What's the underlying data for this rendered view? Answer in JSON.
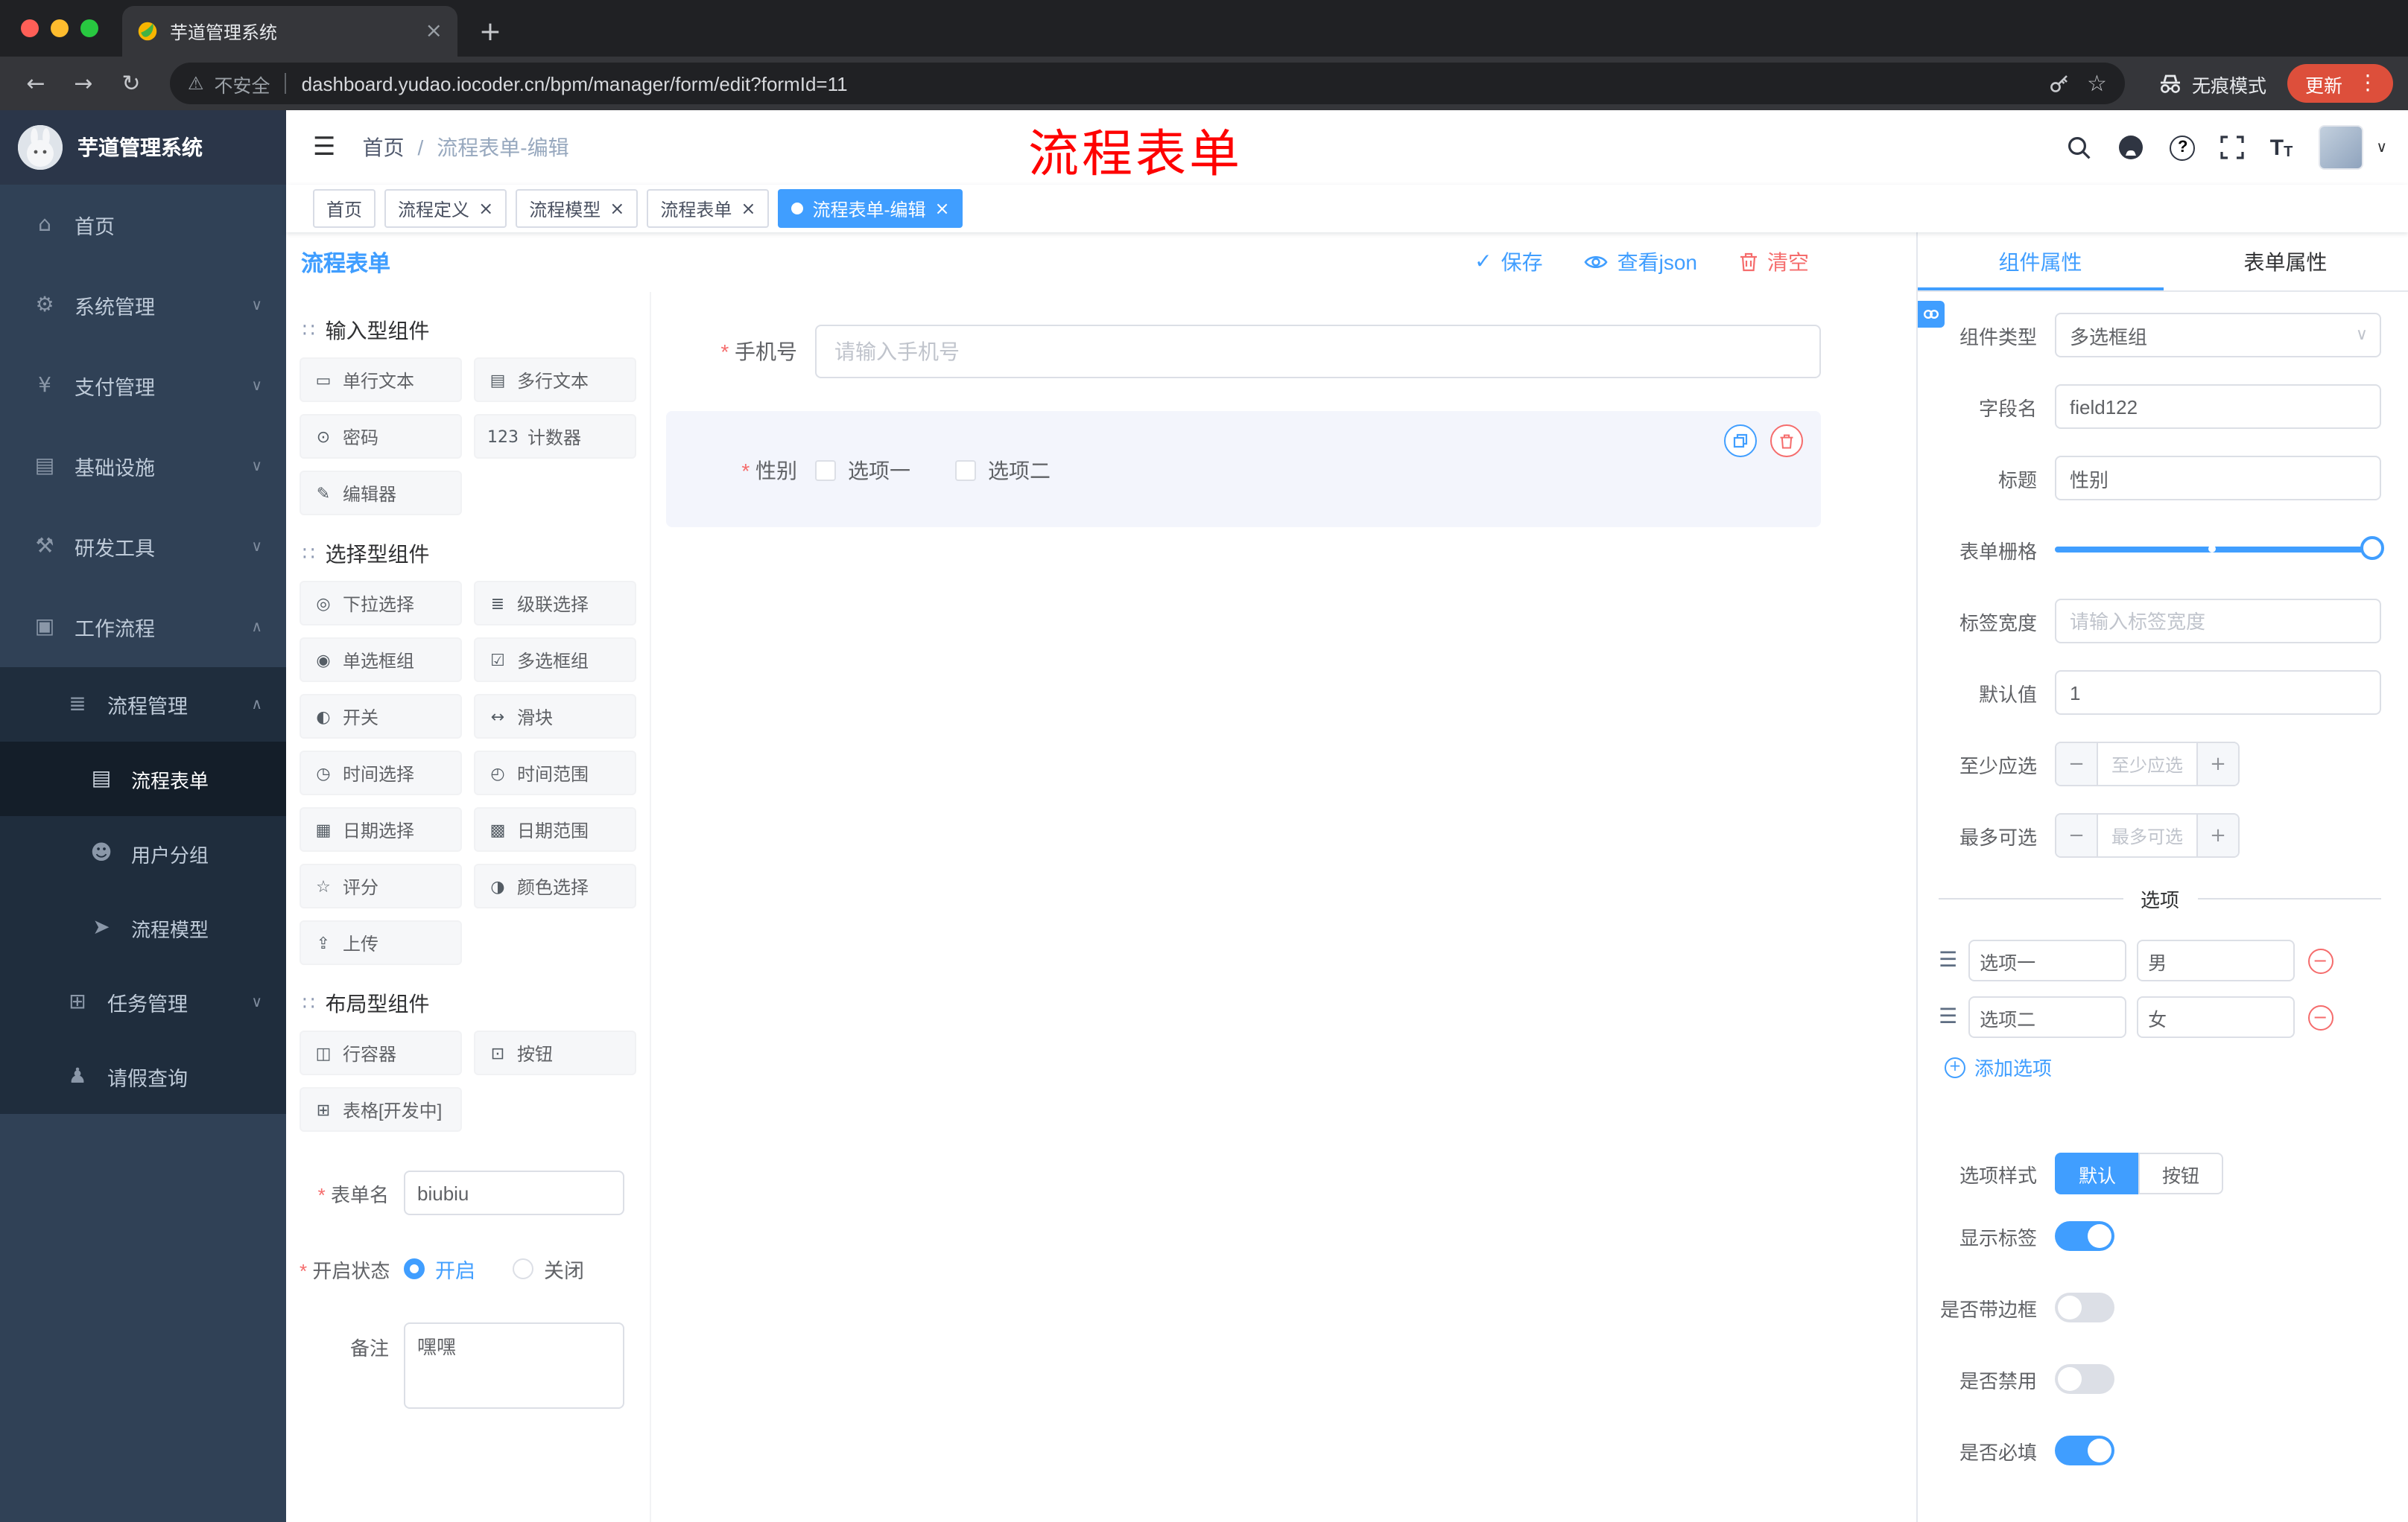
{
  "icons": {
    "close": "×",
    "plus": "+",
    "dots": "⋮",
    "back": "←",
    "forward": "→",
    "reload": "↻",
    "warning": "⚠",
    "star": "☆",
    "caret_down": "∨",
    "caret_up": "∧",
    "check": "✓",
    "hamburger": "☰",
    "minus": "−",
    "grabber": "∷",
    "handle": "☰",
    "font_big": "T",
    "font_small": "T",
    "question": "?",
    "slash": "/"
  },
  "browser": {
    "tab_title": "芋道管理系统",
    "security_label": "不安全",
    "url": "dashboard.yudao.iocoder.cn/bpm/manager/form/edit?formId=11",
    "incognito_label": "无痕模式",
    "update_button": "更新"
  },
  "annotation": {
    "text": "流程表单",
    "color": "#fe0100"
  },
  "navbar": {
    "breadcrumb_home": "首页",
    "breadcrumb_current": "流程表单-编辑"
  },
  "tagsbar": {
    "tags": [
      {
        "label": "首页"
      },
      {
        "label": "流程定义"
      },
      {
        "label": "流程模型"
      },
      {
        "label": "流程表单"
      },
      {
        "label": "流程表单-编辑"
      }
    ]
  },
  "sidebar": {
    "logo_title": "芋道管理系统",
    "items": {
      "home": {
        "icon": "⌂",
        "label": "首页"
      },
      "system": {
        "icon": "⚙",
        "label": "系统管理",
        "arrow": "∨"
      },
      "payment": {
        "icon": "¥",
        "label": "支付管理",
        "arrow": "∨"
      },
      "infra": {
        "icon": "▤",
        "label": "基础设施",
        "arrow": "∨"
      },
      "devtools": {
        "icon": "⚒",
        "label": "研发工具",
        "arrow": "∨"
      },
      "workflow": {
        "icon": "▣",
        "label": "工作流程",
        "arrow": "∧"
      },
      "process_mgmt": {
        "icon": "≣",
        "label": "流程管理",
        "arrow": "∧"
      },
      "process_form": {
        "icon": "▤",
        "label": "流程表单"
      },
      "user_group": {
        "icon": "☻",
        "label": "用户分组"
      },
      "process_model": {
        "icon": "➤",
        "label": "流程模型"
      },
      "task_mgmt": {
        "icon": "⊞",
        "label": "任务管理",
        "arrow": "∨"
      },
      "leave_query": {
        "icon": "♟",
        "label": "请假查询"
      }
    }
  },
  "designer": {
    "title": "流程表单",
    "actions": {
      "save": "保存",
      "view_json": "查看json",
      "clear": "清空"
    },
    "palette": {
      "sections": [
        {
          "title": "输入型组件",
          "items": [
            {
              "icon": "▭",
              "label": "单行文本"
            },
            {
              "icon": "▤",
              "label": "多行文本"
            },
            {
              "icon": "⊙",
              "label": "密码"
            },
            {
              "icon": "123",
              "label": "计数器"
            },
            {
              "icon": "✎",
              "label": "编辑器"
            }
          ]
        },
        {
          "title": "选择型组件",
          "items": [
            {
              "icon": "◎",
              "label": "下拉选择"
            },
            {
              "icon": "≣",
              "label": "级联选择"
            },
            {
              "icon": "◉",
              "label": "单选框组"
            },
            {
              "icon": "☑",
              "label": "多选框组"
            },
            {
              "icon": "◐",
              "label": "开关"
            },
            {
              "icon": "↔",
              "label": "滑块"
            },
            {
              "icon": "◷",
              "label": "时间选择"
            },
            {
              "icon": "◴",
              "label": "时间范围"
            },
            {
              "icon": "▦",
              "label": "日期选择"
            },
            {
              "icon": "▩",
              "label": "日期范围"
            },
            {
              "icon": "☆",
              "label": "评分"
            },
            {
              "icon": "◑",
              "label": "颜色选择"
            },
            {
              "icon": "⇪",
              "label": "上传"
            }
          ]
        },
        {
          "title": "布局型组件",
          "items": [
            {
              "icon": "◫",
              "label": "行容器"
            },
            {
              "icon": "⊡",
              "label": "按钮"
            },
            {
              "icon": "⊞",
              "label": "表格[开发中]"
            }
          ]
        }
      ]
    },
    "form": {
      "name_label": "表单名",
      "name_value": "biubiu",
      "status_label": "开启状态",
      "status_on": "开启",
      "status_off": "关闭",
      "remark_label": "备注",
      "remark_value": "嘿嘿"
    },
    "canvas": {
      "phone": {
        "label": "手机号",
        "placeholder": "请输入手机号"
      },
      "gender": {
        "label": "性别",
        "option1": "选项一",
        "option2": "选项二"
      }
    }
  },
  "panel": {
    "tabs": {
      "component": "组件属性",
      "form": "表单属性"
    },
    "rows": {
      "component_type": {
        "label": "组件类型",
        "value": "多选框组"
      },
      "field_name": {
        "label": "字段名",
        "value": "field122"
      },
      "title": {
        "label": "标题",
        "value": "性别"
      },
      "grid": {
        "label": "表单栅格"
      },
      "label_width": {
        "label": "标签宽度",
        "placeholder": "请输入标签宽度"
      },
      "default_value": {
        "label": "默认值",
        "value": "1"
      },
      "min_select": {
        "label": "至少应选",
        "placeholder": "至少应选"
      },
      "max_select": {
        "label": "最多可选",
        "placeholder": "最多可选"
      }
    },
    "options": {
      "divider": "选项",
      "rows": [
        {
          "name": "选项一",
          "value": "男"
        },
        {
          "name": "选项二",
          "value": "女"
        }
      ],
      "add_label": "添加选项"
    },
    "option_style": {
      "label": "选项样式",
      "default_btn": "默认",
      "button_btn": "按钮"
    },
    "switches": [
      {
        "label": "显示标签",
        "on": true
      },
      {
        "label": "是否带边框",
        "on": false
      },
      {
        "label": "是否禁用",
        "on": false
      },
      {
        "label": "是否必填",
        "on": true
      }
    ],
    "colors": {
      "primary": "#409EFF",
      "danger": "#F56C6C"
    }
  }
}
